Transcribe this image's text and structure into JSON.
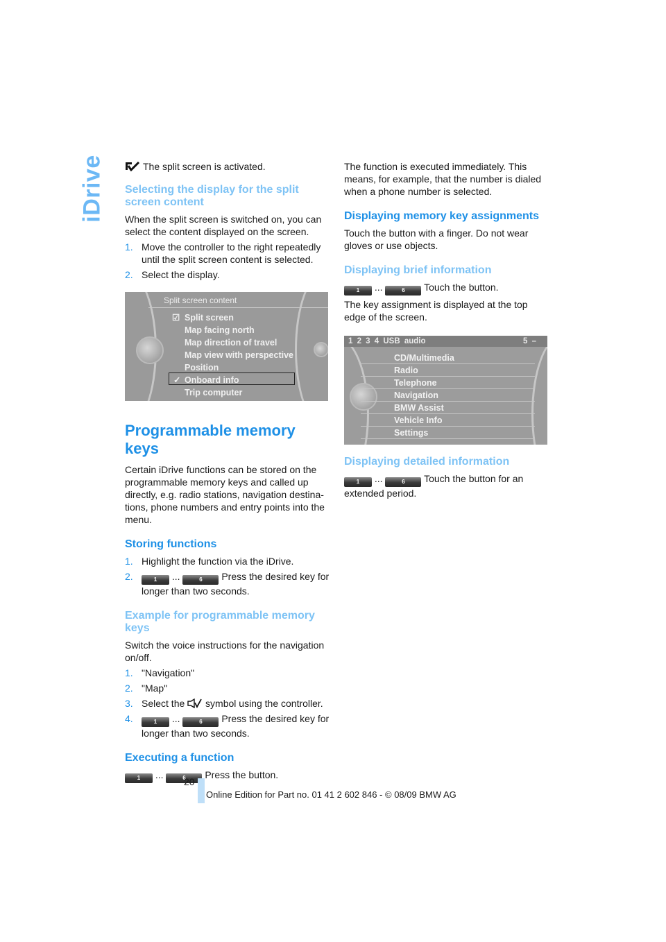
{
  "side_tab": "iDrive",
  "page_number": "20",
  "footer": "Online Edition for Part no. 01 41 2 602 846 - © 08/09 BMW AG",
  "left": {
    "intro": "The split screen is activated.",
    "section1": {
      "heading": "Selecting the display for the split screen content",
      "body": "When the split screen is switched on, you can select the content displayed on the screen.",
      "steps": [
        {
          "num": "1.",
          "text": "Move the controller to the right repeatedly until the split screen content is selected."
        },
        {
          "num": "2.",
          "text": "Select the display."
        }
      ]
    },
    "screen": {
      "title": "Split screen content",
      "items": [
        "Split screen",
        "Map facing north",
        "Map direction of travel",
        "Map view with perspective",
        "Position",
        "Onboard info",
        "Trip computer"
      ],
      "checked_item": "Split screen",
      "selected_item": "Onboard info"
    },
    "main_heading": "Programmable memory keys",
    "main_body": "Certain iDrive functions can be stored on the programmable memory keys and called up directly, e.g. radio stations, navigation destina-tions, phone numbers and entry points into the menu.",
    "storing": {
      "heading": "Storing functions",
      "step1_num": "1.",
      "step1": "Highlight the function via the iDrive.",
      "step2_num": "2.",
      "step2": "Press the desired key for longer than two seconds."
    },
    "example": {
      "heading": "Example for programmable memory keys",
      "body": "Switch the voice instructions for the navigation on/off.",
      "step1_num": "1.",
      "step1": "\"Navigation\"",
      "step2_num": "2.",
      "step2": "\"Map\"",
      "step3_num": "3.",
      "step3_pre": "Select the",
      "step3_post": "symbol using the controller.",
      "step4_num": "4.",
      "step4": "Press the desired key for longer than two seconds."
    },
    "executing": {
      "heading": "Executing a function",
      "text": "Press the button."
    }
  },
  "keys": {
    "first": "1",
    "last": "6",
    "ellipsis": "..."
  },
  "right": {
    "intro": "The function is executed immediately. This means, for example, that the number is dialed when a phone number is selected.",
    "assign": {
      "heading": "Displaying memory key assignments",
      "body": "Touch the button with a finger. Do not wear gloves or use objects."
    },
    "brief": {
      "heading": "Displaying brief information",
      "key_text": "Touch the button.",
      "body": "The key assignment is displayed at the top edge of the screen."
    },
    "screen": {
      "topbar": "1  2  3  4  USB audio",
      "topbar_right": "5 –",
      "items": [
        "CD/Multimedia",
        "Radio",
        "Telephone",
        "Navigation",
        "BMW Assist",
        "Vehicle Info",
        "Settings"
      ]
    },
    "detailed": {
      "heading": "Displaying detailed information",
      "key_text": "Touch the button for an extended period."
    }
  }
}
